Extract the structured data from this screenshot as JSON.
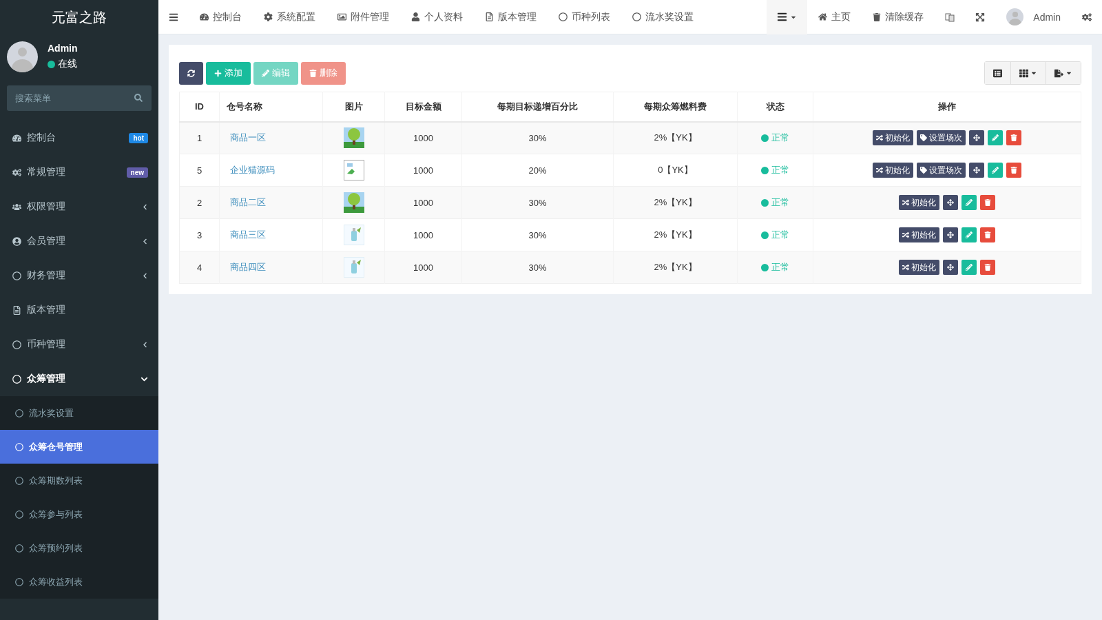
{
  "brand": "元富之路",
  "user": {
    "name": "Admin",
    "status": "在线"
  },
  "menu_search": {
    "placeholder": "搜索菜单"
  },
  "menu": [
    {
      "label": "控制台",
      "badge": {
        "label": "hot",
        "color": "#1e88e5"
      },
      "selected": false
    },
    {
      "label": "常规管理",
      "badge": {
        "label": "new",
        "color": "#605ca8"
      },
      "selected": false
    },
    {
      "label": "权限管理",
      "expanded": false,
      "selected": false
    },
    {
      "label": "会员管理",
      "expanded": false,
      "selected": false
    },
    {
      "label": "财务管理",
      "expanded": false,
      "selected": false
    },
    {
      "label": "版本管理",
      "selected": false
    },
    {
      "label": "币种管理",
      "expanded": false,
      "selected": false
    },
    {
      "label": "众筹管理",
      "selected": true,
      "expanded": true,
      "children": [
        {
          "label": "流水奖设置",
          "selected": false
        },
        {
          "label": "众筹仓号管理",
          "selected": true
        },
        {
          "label": "众筹期数列表",
          "selected": false
        },
        {
          "label": "众筹参与列表",
          "selected": false
        },
        {
          "label": "众筹预约列表",
          "selected": false
        },
        {
          "label": "众筹收益列表",
          "selected": false
        }
      ]
    }
  ],
  "top_nav": [
    "控制台",
    "系统配置",
    "附件管理",
    "个人资料",
    "版本管理",
    "币种列表",
    "流水奖设置"
  ],
  "header_right": [
    {
      "kind": "menu-toggle"
    },
    {
      "kind": "home",
      "label": "主页"
    },
    {
      "kind": "clear-cache",
      "label": "清除缓存"
    },
    {
      "kind": "language"
    },
    {
      "kind": "fullscreen"
    },
    {
      "kind": "user",
      "label": "Admin"
    },
    {
      "kind": "settings"
    }
  ],
  "toolbar": [
    {
      "kind": "refresh",
      "disabled": false
    },
    {
      "kind": "add",
      "label": "添加",
      "disabled": false
    },
    {
      "kind": "edit",
      "label": "编辑",
      "disabled": true
    },
    {
      "kind": "delete",
      "label": "删除",
      "disabled": true
    }
  ],
  "table_tools": [
    {
      "kind": "toggle-view"
    },
    {
      "kind": "columns"
    },
    {
      "kind": "export"
    }
  ],
  "table": {
    "columns": [
      "ID",
      "仓号名称",
      "图片",
      "目标金额",
      "每期目标递增百分比",
      "每期众筹燃料费",
      "状态",
      "操作"
    ],
    "rows": [
      {
        "id": "1",
        "name": "商品一区",
        "image": {
          "kind": "tree"
        },
        "target": "1000",
        "percent": "30%",
        "fee": "2%【YK】",
        "status": "正常",
        "actions": [
          {
            "kind": "init",
            "label": "初始化"
          },
          {
            "kind": "session",
            "label": "设置场次"
          },
          {
            "kind": "move"
          },
          {
            "kind": "edit"
          },
          {
            "kind": "delete"
          }
        ]
      },
      {
        "id": "5",
        "name": "企业猫源码",
        "image": {
          "kind": "broken"
        },
        "target": "1000",
        "percent": "20%",
        "fee": "0【YK】",
        "status": "正常",
        "actions": [
          {
            "kind": "init",
            "label": "初始化"
          },
          {
            "kind": "session",
            "label": "设置场次"
          },
          {
            "kind": "move"
          },
          {
            "kind": "edit"
          },
          {
            "kind": "delete"
          }
        ]
      },
      {
        "id": "2",
        "name": "商品二区",
        "image": {
          "kind": "tree"
        },
        "target": "1000",
        "percent": "30%",
        "fee": "2%【YK】",
        "status": "正常",
        "actions": [
          {
            "kind": "init",
            "label": "初始化"
          },
          {
            "kind": "move"
          },
          {
            "kind": "edit"
          },
          {
            "kind": "delete"
          }
        ]
      },
      {
        "id": "3",
        "name": "商品三区",
        "image": {
          "kind": "bottle"
        },
        "target": "1000",
        "percent": "30%",
        "fee": "2%【YK】",
        "status": "正常",
        "actions": [
          {
            "kind": "init",
            "label": "初始化"
          },
          {
            "kind": "move"
          },
          {
            "kind": "edit"
          },
          {
            "kind": "delete"
          }
        ]
      },
      {
        "id": "4",
        "name": "商品四区",
        "image": {
          "kind": "bottle"
        },
        "target": "1000",
        "percent": "30%",
        "fee": "2%【YK】",
        "status": "正常",
        "actions": [
          {
            "kind": "init",
            "label": "初始化"
          },
          {
            "kind": "move"
          },
          {
            "kind": "edit"
          },
          {
            "kind": "delete"
          }
        ]
      }
    ]
  }
}
